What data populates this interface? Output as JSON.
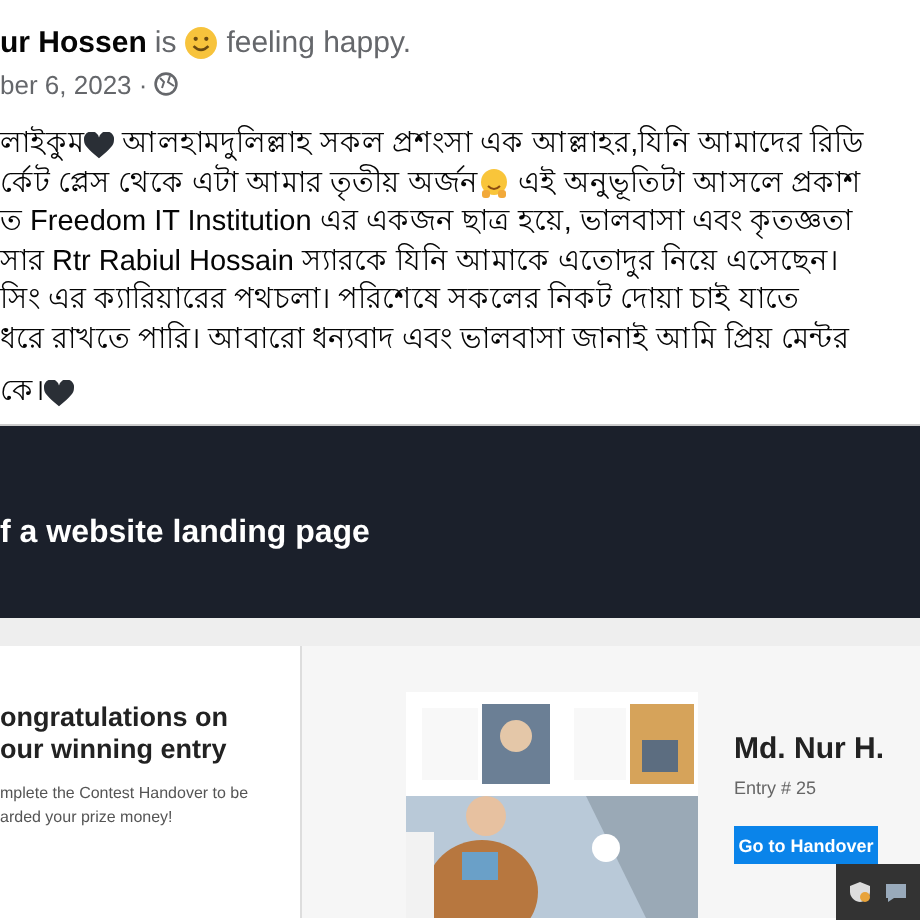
{
  "post": {
    "author": "ur Hossen",
    "verb": "is",
    "feeling": "feeling happy.",
    "date": "ber 6, 2023 ·",
    "lines": [
      [
        {
          "kind": "text",
          "text": "লাইকুম"
        },
        {
          "kind": "heart"
        },
        {
          "kind": "text",
          "text": " আলহামদুলিল্লাহ সকল প্রশংসা এক আল্লাহর,যিনি আমাদের রিডি"
        }
      ],
      [
        {
          "kind": "text",
          "text": "র্কেট প্লেস থেকে এটা আমার তৃতীয় অর্জন"
        },
        {
          "kind": "hug"
        },
        {
          "kind": "text",
          "text": " এই অনুভূতিটা আসলে প্রকাশ"
        }
      ],
      [
        {
          "kind": "text",
          "text": "ত Freedom IT Institution এর একজন ছাত্র হয়ে, ভালবাসা এবং কৃতজ্ঞতা"
        }
      ],
      [
        {
          "kind": "text",
          "text": "সার Rtr Rabiul Hossain স্যারকে যিনি আমাকে এতোদুর নিয়ে এসেছেন।"
        }
      ],
      [
        {
          "kind": "text",
          "text": "সিং এর ক্যারিয়ারের পথচলা। পরিশেষে সকলের নিকট দোয়া চাই যাতে"
        }
      ],
      [
        {
          "kind": "text",
          "text": "ধরে রাখতে পারি। আবারো ধন্যবাদ এবং ভালবাসা জানাই আমি প্রিয় মেন্টর"
        }
      ],
      [
        {
          "kind": "text",
          "text": "কে।"
        },
        {
          "kind": "heart"
        }
      ]
    ]
  },
  "banner": {
    "title": "f a website landing page"
  },
  "contest": {
    "heading": [
      "ongratulations on",
      "our winning entry"
    ],
    "message": [
      "mplete the Contest Handover to be",
      "arded your prize money!"
    ],
    "winner": "Md. Nur H.",
    "entry": "Entry # 25",
    "button": "Go to Handover"
  }
}
